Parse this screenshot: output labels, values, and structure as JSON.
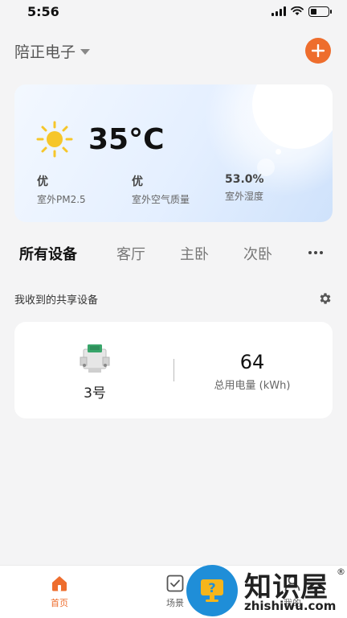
{
  "status_bar": {
    "time": "5:56"
  },
  "header": {
    "home_name": "陪正电子",
    "add_icon": "plus-icon"
  },
  "weather": {
    "icon": "sun-icon",
    "temperature": "35°C",
    "metrics": [
      {
        "value": "优",
        "label": "室外PM2.5"
      },
      {
        "value": "优",
        "label": "室外空气质量"
      },
      {
        "value": "53.0%",
        "label": "室外湿度"
      }
    ]
  },
  "tabs": [
    {
      "label": "所有设备",
      "active": true
    },
    {
      "label": "客厅"
    },
    {
      "label": "主卧"
    },
    {
      "label": "次卧"
    }
  ],
  "shared": {
    "title": "我收到的共享设备"
  },
  "device": {
    "name": "3号",
    "power_value": "64",
    "power_label": "总用电量 (kWh)"
  },
  "bottom_nav": [
    {
      "label": "首页",
      "icon": "home-icon",
      "active": true
    },
    {
      "label": "场景",
      "icon": "scene-icon"
    },
    {
      "label": "我的",
      "icon": "profile-icon"
    }
  ],
  "watermark": {
    "brand": "知识屋",
    "url": "zhishiwu.com",
    "reg": "®"
  },
  "colors": {
    "accent": "#ee6d2d",
    "watermark_blue": "#1f8ed8"
  }
}
